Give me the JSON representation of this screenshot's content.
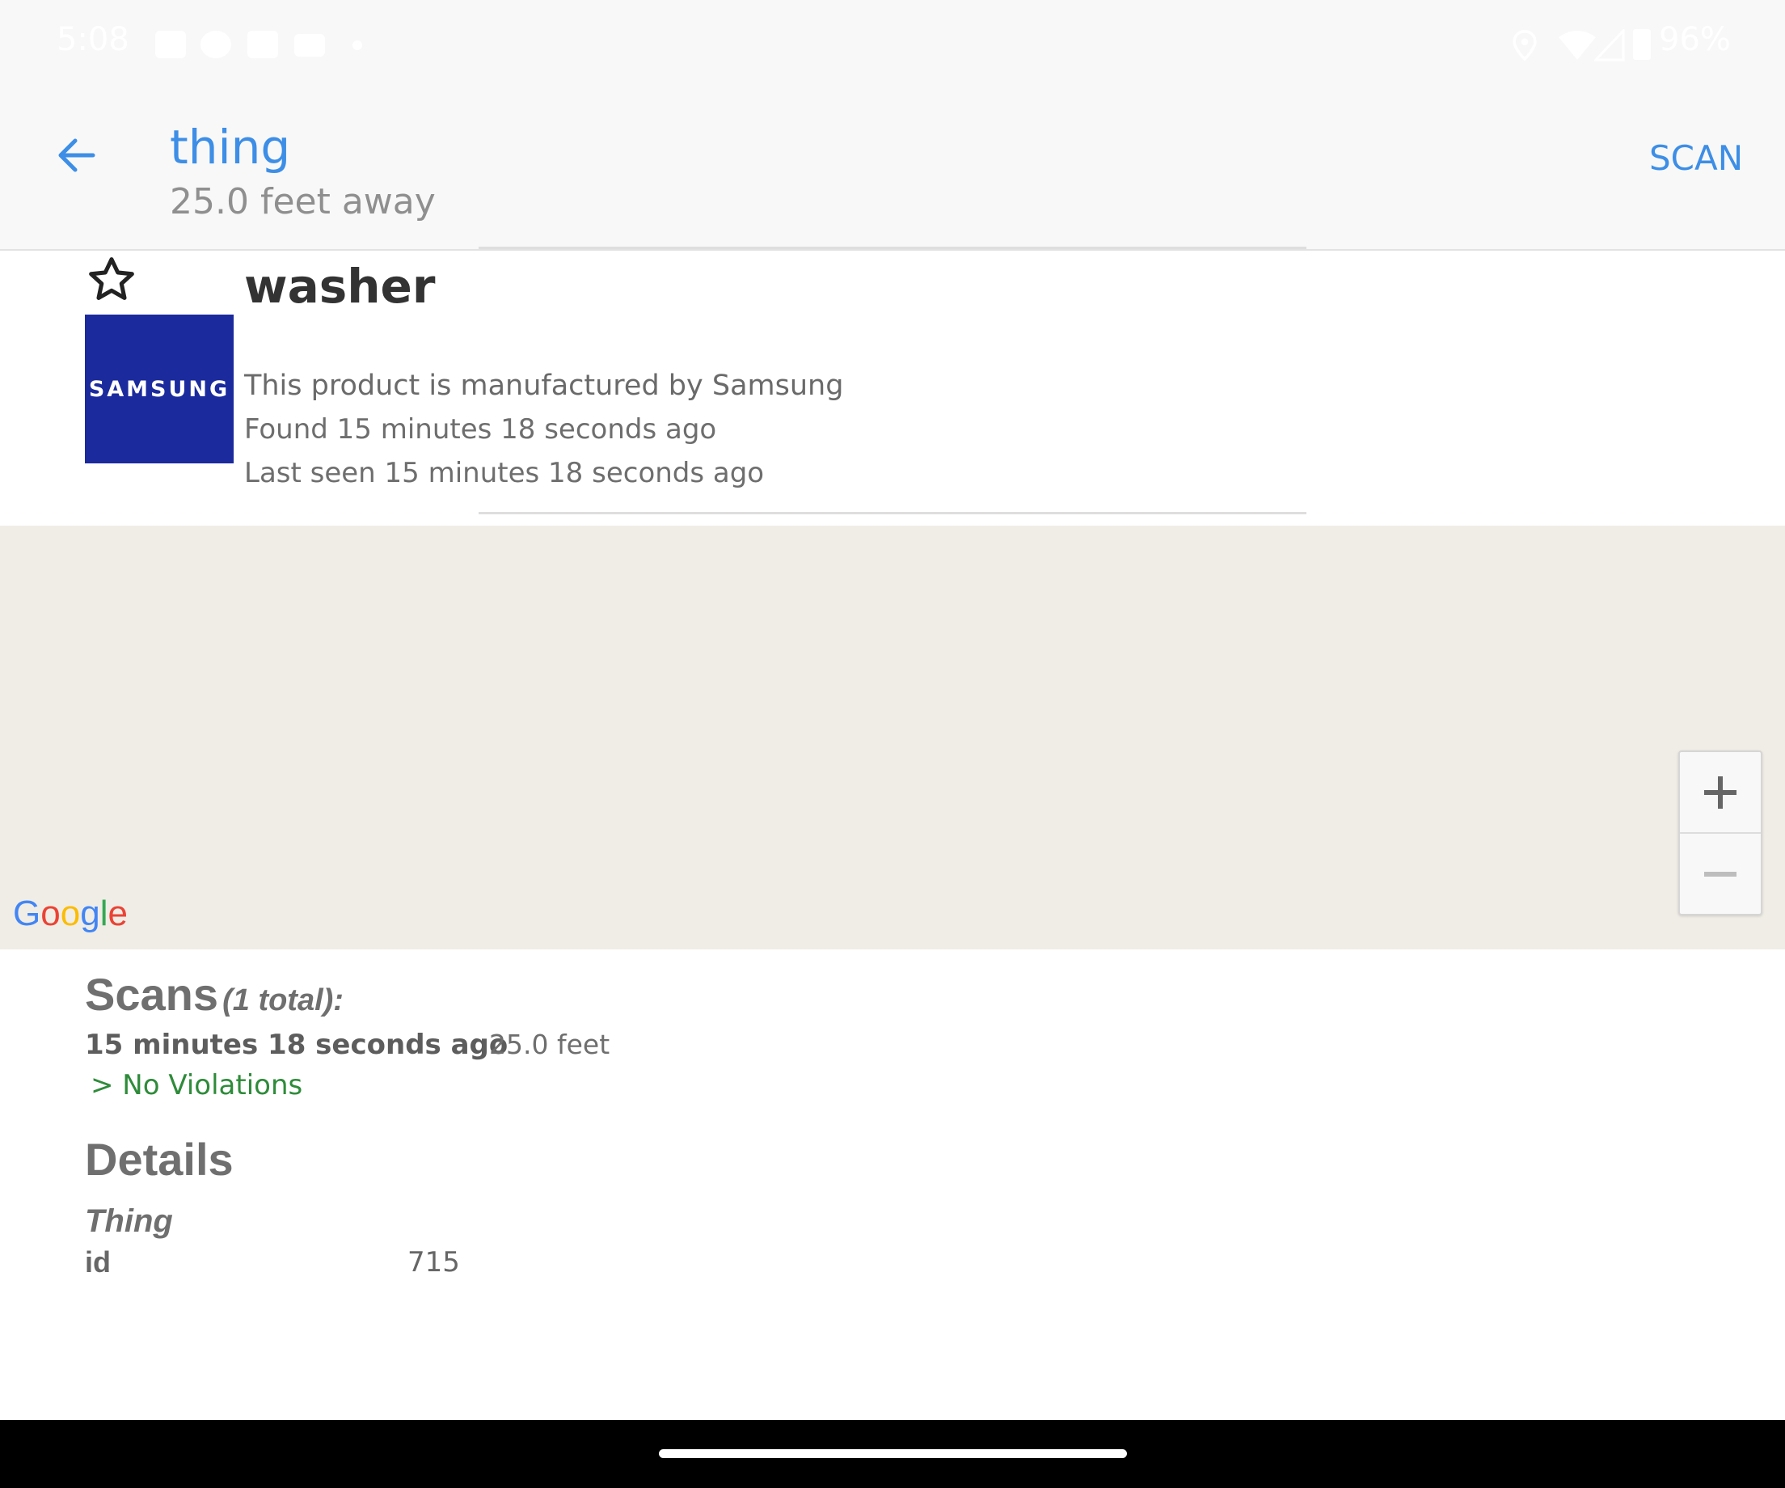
{
  "status_bar": {
    "time": "5:08",
    "battery": "96%"
  },
  "app_bar": {
    "title": "thing",
    "subtitle": "25.0 feet away",
    "scan_label": "SCAN",
    "back_icon": "arrow-left-icon"
  },
  "device": {
    "name": "washer",
    "brand_logo_text": "SAMSUNG",
    "manufacturer_line": "This product is manufactured by Samsung",
    "found_line": "Found 15 minutes 18 seconds ago",
    "last_seen_line": "Last seen 15 minutes 18 seconds ago",
    "favorite_icon": "star-outline-icon"
  },
  "map": {
    "google_logo": [
      "G",
      "o",
      "o",
      "g",
      "l",
      "e"
    ],
    "zoom_in": "+",
    "zoom_out": "−",
    "background_color": "#f0ede6"
  },
  "scans": {
    "title": "Scans",
    "count_label": "(1 total):",
    "items": [
      {
        "time": "15 minutes 18 seconds ago",
        "distance": "25.0 feet",
        "violations": "> No Violations"
      }
    ]
  },
  "details": {
    "title": "Details",
    "section": "Thing",
    "rows": [
      {
        "key": "id",
        "value": "715"
      }
    ]
  },
  "colors": {
    "accent": "#3d8ee6",
    "brand_blue": "#1b2a9c",
    "ok_green": "#2e8b3a"
  }
}
